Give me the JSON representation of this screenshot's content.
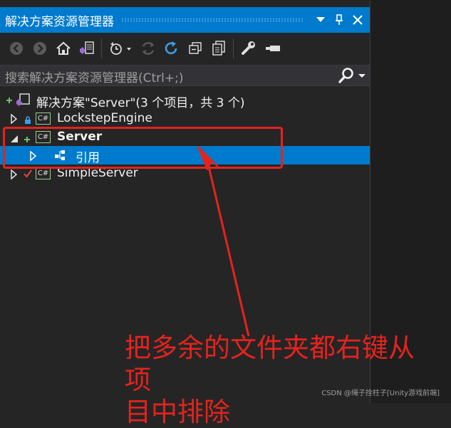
{
  "window": {
    "title": "解决方案资源管理器",
    "pin_icon": "pin-icon",
    "close_icon": "close-icon",
    "dropdown_icon": "dropdown-arrow-icon"
  },
  "toolbar": {
    "icons": [
      "back-icon",
      "forward-icon",
      "home-icon",
      "switch-views-icon",
      "pending-changes-filter-icon",
      "sync-icon",
      "refresh-icon",
      "collapse-all-icon",
      "show-all-files-icon",
      "properties-icon",
      "preview-icon"
    ]
  },
  "search": {
    "placeholder": "搜索解决方案资源管理器(Ctrl+;)"
  },
  "tree": {
    "solution": "解决方案\"Server\"(3 个项目，共 3 个)",
    "items": [
      {
        "label": "LockstepEngine",
        "status": "locked"
      },
      {
        "label": "Server",
        "status": "added",
        "expanded": true
      },
      {
        "label": "引用",
        "status": "references",
        "selected": true
      },
      {
        "label": "SimpleServer",
        "status": "checked-out"
      }
    ],
    "project_badge": "C#"
  },
  "annotation": {
    "text_line1": "把多余的文件夹都右键从项",
    "text_line2": "目中排除"
  },
  "watermark": "CSDN @绳子拴柱子[Unity游戏前端]",
  "colors": {
    "accent": "#007acc",
    "panel_bg": "#252526",
    "annotation_red": "#e5231d",
    "add_green": "#6bc46d",
    "lock_blue": "#3c9ee8",
    "check_red": "#e0453a"
  }
}
